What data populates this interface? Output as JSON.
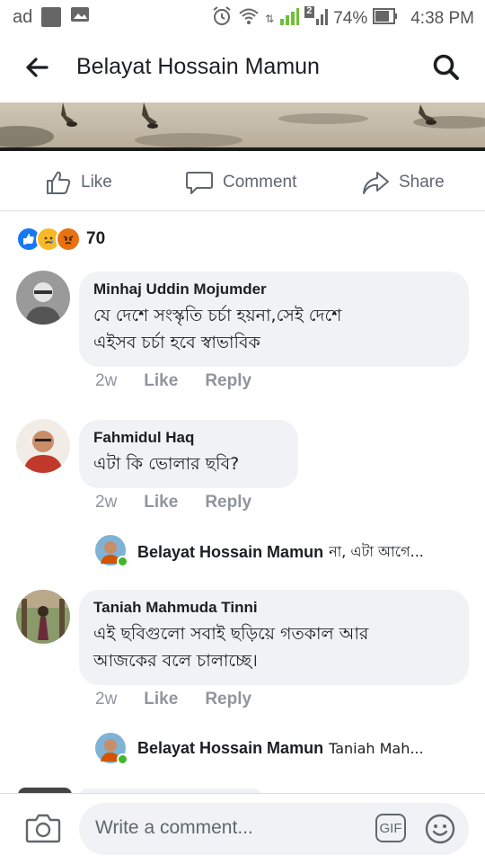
{
  "status_bar": {
    "left_label": "ad",
    "battery": "74%",
    "time": "4:38 PM",
    "sim2": "2"
  },
  "header": {
    "title": "Belayat Hossain Mamun"
  },
  "actions": {
    "like": "Like",
    "comment": "Comment",
    "share": "Share"
  },
  "reactions": {
    "count": "70",
    "types": [
      "like-icon",
      "sad-icon",
      "angry-icon"
    ]
  },
  "comments": [
    {
      "author": "Minhaj Uddin Mojumder",
      "lines": [
        "যে দেশে সংস্কৃতি চর্চা হয়না,সেই দেশে",
        "এইসব চর্চা হবে স্বাভাবিক"
      ],
      "time": "2w",
      "like": "Like",
      "reply": "Reply"
    },
    {
      "author": "Fahmidul Haq",
      "lines": [
        "এটা কি ভোলার ছবি?"
      ],
      "time": "2w",
      "like": "Like",
      "reply": "Reply",
      "reply_preview": {
        "author": "Belayat Hossain Mamun",
        "text": "না, এটা আগে..."
      }
    },
    {
      "author": "Taniah Mahmuda Tinni",
      "lines": [
        "এই ছবিগুলো সবাই ছড়িয়ে গতকাল আর",
        "আজকের বলে চালাচ্ছে।"
      ],
      "time": "2w",
      "like": "Like",
      "reply": "Reply",
      "reply_preview": {
        "author": "Belayat Hossain Mamun",
        "text": "Taniah Mah..."
      }
    }
  ],
  "composer": {
    "placeholder": "Write a comment...",
    "gif": "GIF"
  },
  "colors": {
    "like_blue": "#1877f2",
    "sad_yellow": "#f7b928",
    "angry_orange": "#e9710f",
    "meta_grey": "#90949c",
    "bubble_bg": "#f0f2f5",
    "online_green": "#42b72a"
  }
}
